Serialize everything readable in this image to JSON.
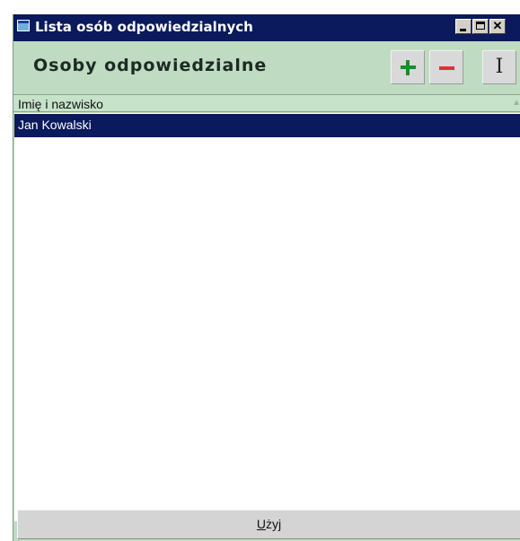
{
  "window": {
    "title": "Lista osób odpowiedzialnych",
    "minimize_icon": "minimize-icon",
    "maximize_icon": "maximize-icon",
    "close_icon": "close-icon",
    "close_glyph": "✕"
  },
  "header": {
    "title": "Osoby odpowiedzialne",
    "add_icon": "plus-icon",
    "remove_icon": "minus-icon",
    "edit_icon": "text-cursor-icon",
    "edit_glyph": "I"
  },
  "list": {
    "columns": [
      {
        "label": "Imię i nazwisko",
        "sort": "ascending"
      }
    ],
    "sort_glyph": "▲",
    "rows": [
      {
        "name": "Jan Kowalski",
        "selected": true
      }
    ]
  },
  "footer": {
    "use_button_label": "Użyj",
    "use_button_access_key": "U"
  },
  "colors": {
    "titlebar": "#0a1a5c",
    "background": "#bfdcc2",
    "selection": "#0a1a5c",
    "add": "#1f8a2a",
    "remove": "#e0303a"
  }
}
